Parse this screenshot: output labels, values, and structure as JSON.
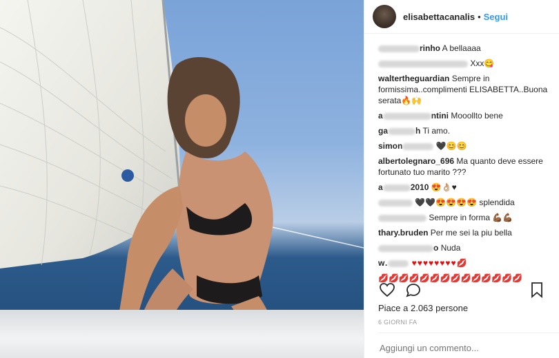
{
  "post": {
    "username": "elisabettacanalis",
    "separator": "•",
    "follow_label": "Segui",
    "likes_text": "Piace a 2.063 persone",
    "time_ago": "6 GIORNI FA",
    "comment_placeholder": "Aggiungi un commento..."
  },
  "comments": [
    {
      "user_visible": "rinho",
      "text": "A bellaaaa"
    },
    {
      "user_visible": "",
      "text": "Xxx😋"
    },
    {
      "user_visible": "waltertheguardian",
      "text": "Sempre in formissima..complimenti ELISABETTA..Buona serata🔥🙌"
    },
    {
      "user_visible": "a",
      "user_tail": "ntini",
      "text": "Mooollto bene"
    },
    {
      "user_visible": "ga",
      "user_tail": "h",
      "text": "Ti amo."
    },
    {
      "user_visible": "simon",
      "text": "🖤😊😊"
    },
    {
      "user_visible": "albertolegnaro_696",
      "text": "Ma quanto deve essere fortunato tuo marito ???"
    },
    {
      "user_visible": "a",
      "user_tail": "2010",
      "text": "😍👌🏼♥"
    },
    {
      "user_visible": "",
      "text": "🖤🖤😍😍😍😍 splendida"
    },
    {
      "user_visible": "",
      "text": "Sempre in forma 💪🏾💪🏾"
    },
    {
      "user_visible": "thary.bruden",
      "text": "Per me sei la piu bella"
    },
    {
      "user_visible": "",
      "user_tail": "o",
      "text": "Nuda"
    },
    {
      "user_visible": "w.",
      "text": "♥♥♥♥♥♥♥♥💋"
    },
    {
      "user_visible": "",
      "text": "💋💋💋💋💋💋💋💋💋💋💋💋💋💋"
    }
  ],
  "icons": {
    "like": "heart-icon",
    "comment": "comment-icon",
    "save": "bookmark-icon"
  },
  "colors": {
    "accent": "#3897f0",
    "text": "#262626",
    "muted": "#999999"
  }
}
